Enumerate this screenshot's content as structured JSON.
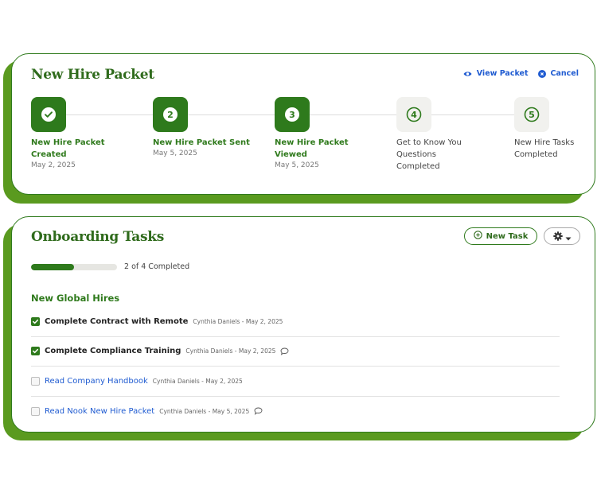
{
  "packet": {
    "title": "New Hire Packet",
    "view_packet_label": "View Packet",
    "cancel_label": "Cancel",
    "steps": [
      {
        "number": "✓",
        "name": "New Hire Packet Created",
        "date": "May 2, 2025",
        "status": "done"
      },
      {
        "number": "2",
        "name": "New Hire Packet Sent",
        "date": "May 5, 2025",
        "status": "done"
      },
      {
        "number": "3",
        "name": "New Hire Packet Viewed",
        "date": "May 5, 2025",
        "status": "done"
      },
      {
        "number": "4",
        "name": "Get to Know You Questions Completed",
        "date": "",
        "status": "pending"
      },
      {
        "number": "5",
        "name": "New Hire Tasks Completed",
        "date": "",
        "status": "pending"
      }
    ]
  },
  "tasks": {
    "title": "Onboarding Tasks",
    "new_task_label": "New Task",
    "progress": {
      "completed": 2,
      "total": 4,
      "text": "2 of 4 Completed"
    },
    "section_title": "New Global Hires",
    "items": [
      {
        "title": "Complete Contract with Remote",
        "meta": "Cynthia Daniels - May 2, 2025",
        "checked": true,
        "comment": false
      },
      {
        "title": "Complete Compliance Training",
        "meta": "Cynthia Daniels - May 2, 2025",
        "checked": true,
        "comment": true
      },
      {
        "title": "Read Company Handbook",
        "meta": "Cynthia Daniels - May 2, 2025",
        "checked": false,
        "comment": false
      },
      {
        "title": "Read Nook New Hire Packet",
        "meta": "Cynthia Daniels - May 5, 2025",
        "checked": false,
        "comment": true
      }
    ]
  },
  "colors": {
    "brand_green": "#2e7a1c",
    "shadow_green": "#5a9a1f",
    "link_blue": "#1f5bd1"
  },
  "icons": {
    "view_packet": "eye-icon",
    "cancel": "cancel-circle-icon",
    "new_task": "plus-circle-icon",
    "settings": "gear-icon",
    "settings_menu": "caret-down-icon",
    "comment": "comment-icon",
    "checkbox": "checkmark-icon"
  }
}
